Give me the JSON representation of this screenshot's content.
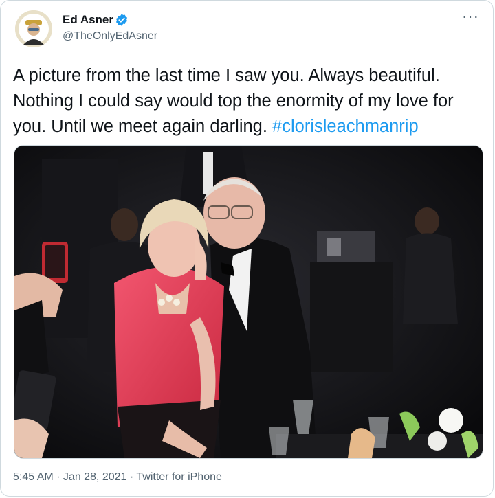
{
  "author": {
    "name": "Ed Asner",
    "handle": "@TheOnlyEdAsner",
    "verified_icon": "verified-badge-icon",
    "avatar_icon": "profile-avatar-icon"
  },
  "menu": {
    "more_label": "···"
  },
  "tweet": {
    "text_before": "A picture from the last time I saw you. Always beautiful. Nothing I could say would top the enormity of my love for you. Until we meet again darling. ",
    "hashtag": "#clorisleachmanrip"
  },
  "photo": {
    "alt": ""
  },
  "meta": {
    "time": "5:45 AM",
    "sep1": " · ",
    "date": "Jan 28, 2021",
    "sep2": " · ",
    "source": "Twitter for iPhone"
  },
  "colors": {
    "accent": "#1d9bf0",
    "secondary_text": "#536471",
    "border": "#cfd9de"
  }
}
